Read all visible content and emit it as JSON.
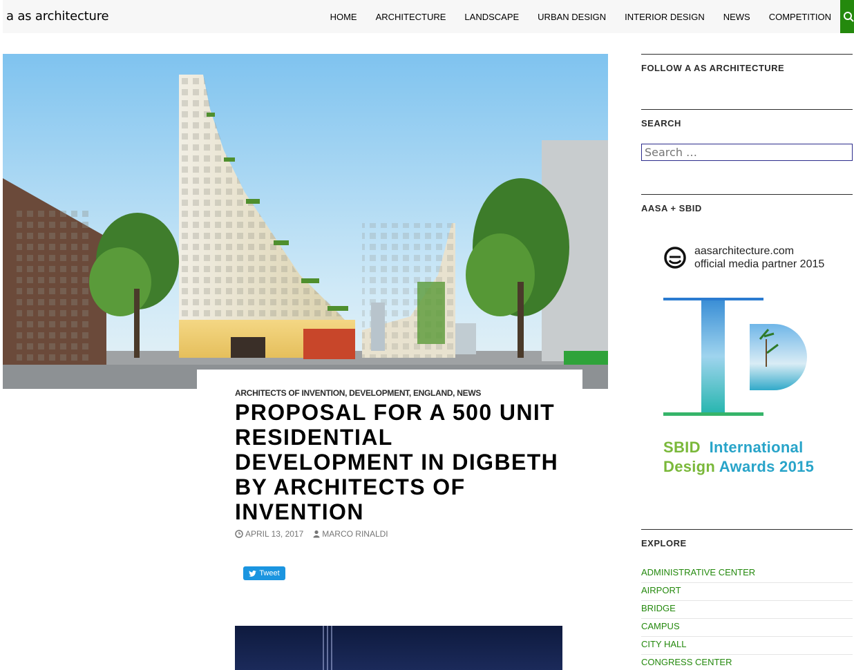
{
  "site": {
    "title": "a as architecture"
  },
  "nav": {
    "items": [
      "HOME",
      "ARCHITECTURE",
      "LANDSCAPE",
      "URBAN DESIGN",
      "INTERIOR DESIGN",
      "NEWS",
      "COMPETITION"
    ]
  },
  "post": {
    "categories": "ARCHITECTS OF INVENTION, DEVELOPMENT, ENGLAND, NEWS",
    "title": "PROPOSAL FOR A 500 UNIT RESIDENTIAL DEVELOPMENT IN DIGBETH BY ARCHITECTS OF INVENTION",
    "date": "APRIL 13, 2017",
    "author": "MARCO RINALDI",
    "tweet_label": "Tweet"
  },
  "sidebar": {
    "follow_title": "FOLLOW A AS ARCHITECTURE",
    "search_title": "SEARCH",
    "search_placeholder": "Search …",
    "partner_title": "AASA + SBID",
    "partner_line1": "aasarchitecture.com",
    "partner_line2": "official media partner 2015",
    "sbid_word1": "SBID",
    "sbid_word2": "International",
    "sbid_word3": "Design",
    "sbid_word4": "Awards 2015",
    "explore_title": "EXPLORE",
    "explore_items": [
      "ADMINISTRATIVE CENTER",
      "AIRPORT",
      "BRIDGE",
      "CAMPUS",
      "CITY HALL",
      "CONGRESS CENTER"
    ]
  },
  "colors": {
    "accent_green": "#24890d",
    "tweet_blue": "#1b95e0",
    "sbid_blue": "#28a4c9",
    "sbid_green": "#7ab83a"
  },
  "icons": {
    "search": "search-icon",
    "clock": "clock-icon",
    "user": "user-icon",
    "twitter": "twitter-bird-icon"
  }
}
